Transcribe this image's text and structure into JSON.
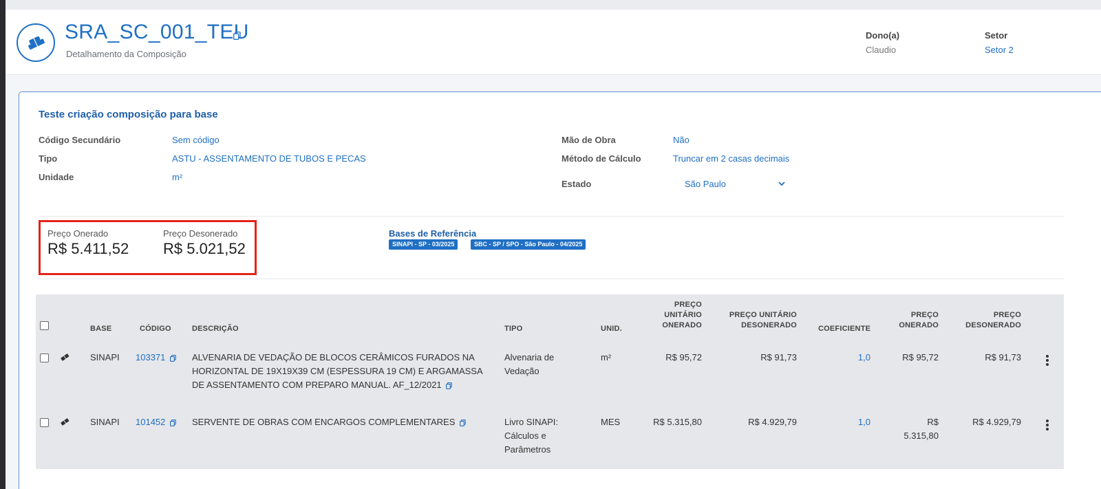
{
  "header": {
    "title": "SRA_SC_001_TEU",
    "subtitle": "Detalhamento da Composição",
    "owner_label": "Dono(a)",
    "owner_value": "Claudio",
    "sector_label": "Setor",
    "sector_value": "Setor 2"
  },
  "card": {
    "title": "Teste criação composição para base",
    "fields": {
      "codigo_secundario_label": "Código Secundário",
      "codigo_secundario_value": "Sem código",
      "tipo_label": "Tipo",
      "tipo_value": "ASTU - ASSENTAMENTO DE TUBOS E PECAS",
      "unidade_label": "Unidade",
      "unidade_value": "m²",
      "mao_de_obra_label": "Mão de Obra",
      "mao_de_obra_value": "Não",
      "metodo_label": "Método de Cálculo",
      "metodo_value": "Truncar em 2 casas decimais",
      "estado_label": "Estado",
      "estado_value": "São Paulo"
    },
    "prices": {
      "onerado_label": "Preço Onerado",
      "onerado_value": "R$ 5.411,52",
      "desonerado_label": "Preço Desonerado",
      "desonerado_value": "R$ 5.021,52"
    },
    "bases": {
      "title": "Bases de Referência",
      "badges": [
        "SINAPI - SP - 03/2025",
        "SBC - SP / SPO - São Paulo - 04/2025"
      ]
    }
  },
  "table": {
    "headers": {
      "base": "BASE",
      "codigo": "CÓDIGO",
      "descricao": "DESCRIÇÃO",
      "tipo": "TIPO",
      "unid": "UNID.",
      "pu_onerado_1": "PREÇO",
      "pu_onerado_2": "UNITÁRIO",
      "pu_onerado_3": "ONERADO",
      "pu_desonerado_1": "PREÇO UNITÁRIO",
      "pu_desonerado_2": "DESONERADO",
      "coeficiente": "COEFICIENTE",
      "p_onerado_1": "PREÇO",
      "p_onerado_2": "ONERADO",
      "p_desonerado_1": "PREÇO",
      "p_desonerado_2": "DESONERADO"
    },
    "rows": [
      {
        "base": "SINAPI",
        "codigo": "103371",
        "descricao_1": "ALVENARIA DE VEDAÇÃO DE BLOCOS CERÂMICOS FURADOS NA",
        "descricao_2": "HORIZONTAL DE 19X19X39 CM (ESPESSURA 19 CM) E ARGAMASSA",
        "descricao_3": "DE ASSENTAMENTO COM PREPARO MANUAL. AF_12/2021",
        "tipo_1": "Alvenaria de",
        "tipo_2": "Vedação",
        "tipo_3": "",
        "unid": "m²",
        "pu_onerado": "R$ 95,72",
        "pu_desonerado": "R$ 91,73",
        "coeficiente": "1,0",
        "p_onerado_1": "R$ 95,72",
        "p_onerado_2": "",
        "p_desonerado": "R$ 91,73"
      },
      {
        "base": "SINAPI",
        "codigo": "101452",
        "descricao_1": "SERVENTE DE OBRAS COM ENCARGOS COMPLEMENTARES",
        "descricao_2": "",
        "descricao_3": "",
        "tipo_1": "Livro SINAPI:",
        "tipo_2": "Cálculos e",
        "tipo_3": "Parâmetros",
        "unid": "MES",
        "pu_onerado": "R$ 5.315,80",
        "pu_desonerado": "R$ 4.929,79",
        "coeficiente": "1,0",
        "p_onerado_1": "R$",
        "p_onerado_2": "5.315,80",
        "p_desonerado": "R$ 4.929,79"
      }
    ]
  },
  "colors": {
    "accent": "#1f6fc4",
    "highlight": "#e2231a"
  }
}
